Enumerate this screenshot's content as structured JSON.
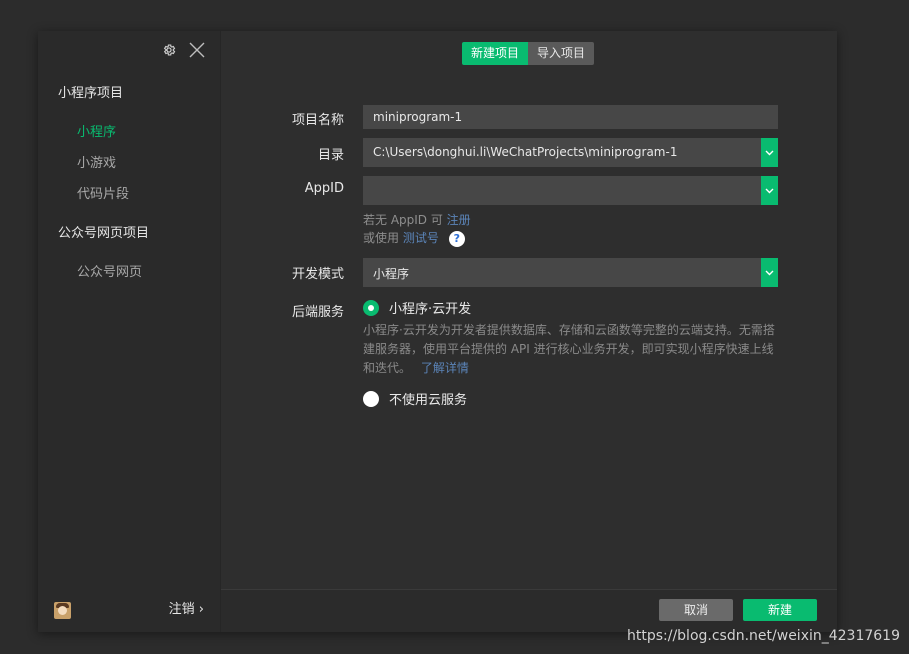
{
  "sidebar": {
    "section_mini": "小程序项目",
    "items_mini": [
      "小程序",
      "小游戏",
      "代码片段"
    ],
    "section_official": "公众号网页项目",
    "items_official": [
      "公众号网页"
    ],
    "logout_label": "注销 ›",
    "icons": {
      "settings": "gear-icon",
      "close": "close-icon"
    }
  },
  "tabs": [
    "新建项目",
    "导入项目"
  ],
  "form": {
    "name_label": "项目名称",
    "name_value": "miniprogram-1",
    "dir_label": "目录",
    "dir_value": "C:\\Users\\donghui.li\\WeChatProjects\\miniprogram-1",
    "appid_label": "AppID",
    "appid_value": "",
    "appid_hint1_prefix": "若无 AppID 可 ",
    "appid_hint1_link": "注册",
    "appid_hint2_prefix": "或使用 ",
    "appid_hint2_link": "测试号",
    "help_glyph": "?",
    "mode_label": "开发模式",
    "mode_value": "小程序",
    "backend_label": "后端服务",
    "option_cloud": "小程序·云开发",
    "cloud_desc": "小程序·云开发为开发者提供数据库、存储和云函数等完整的云端支持。无需搭建服务器，使用平台提供的 API 进行核心业务开发，即可实现小程序快速上线和迭代。",
    "cloud_link": "了解详情",
    "option_none": "不使用云服务"
  },
  "footer": {
    "cancel_label": "取消",
    "create_label": "新建"
  },
  "watermark": "https://blog.csdn.net/weixin_42317619",
  "colors": {
    "accent": "#09bb70",
    "field_bg": "#474747",
    "link": "#5b84b8"
  }
}
